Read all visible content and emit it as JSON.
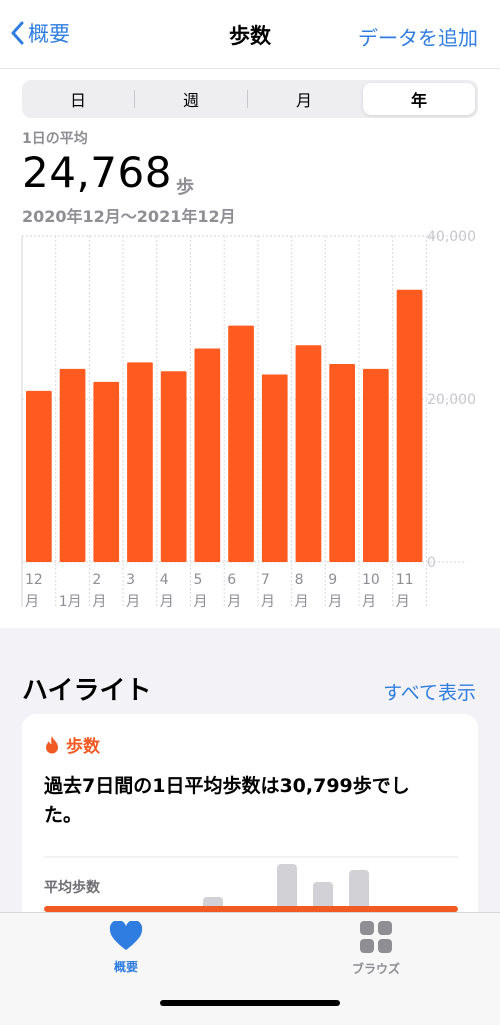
{
  "nav": {
    "back_label": "概要",
    "title": "歩数",
    "add_label": "データを追加"
  },
  "segments": [
    {
      "label": "日",
      "active": false
    },
    {
      "label": "週",
      "active": false
    },
    {
      "label": "月",
      "active": false
    },
    {
      "label": "年",
      "active": true
    }
  ],
  "summary": {
    "label": "1日の平均",
    "value": "24,768",
    "unit": "歩",
    "range": "2020年12月～2021年12月"
  },
  "chart_data": {
    "type": "bar",
    "categories": [
      "12月",
      "1月",
      "2月",
      "3月",
      "4月",
      "5月",
      "6月",
      "7月",
      "8月",
      "9月",
      "10月",
      "11月"
    ],
    "tick_labels": [
      [
        "12",
        "月"
      ],
      [
        "",
        "1月"
      ],
      [
        "2",
        "月"
      ],
      [
        "3",
        "月"
      ],
      [
        "4",
        "月"
      ],
      [
        "5",
        "月"
      ],
      [
        "6",
        "月"
      ],
      [
        "7",
        "月"
      ],
      [
        "8",
        "月"
      ],
      [
        "9",
        "月"
      ],
      [
        "10",
        "月"
      ],
      [
        "11",
        "月"
      ]
    ],
    "values": [
      21000,
      23700,
      22100,
      24500,
      23400,
      26200,
      29000,
      23000,
      26600,
      24300,
      23700,
      33400
    ],
    "ylim": [
      0,
      40000
    ],
    "yticks": [
      {
        "v": 40000,
        "label": "40,000"
      },
      {
        "v": 20000,
        "label": "20,000"
      },
      {
        "v": 0,
        "label": "0"
      }
    ],
    "bar_color": "#ff5a1f",
    "grid": true
  },
  "highlights": {
    "title": "ハイライト",
    "see_all": "すべて表示",
    "card": {
      "category": "歩数",
      "text": "過去7日間の1日平均歩数は30,799歩でした。",
      "chart_label": "平均歩数",
      "accent": "#f25a24"
    }
  },
  "tabs": [
    {
      "label": "概要",
      "icon": "heart-icon",
      "active": true
    },
    {
      "label": "ブラウズ",
      "icon": "grid-icon",
      "active": false
    }
  ]
}
